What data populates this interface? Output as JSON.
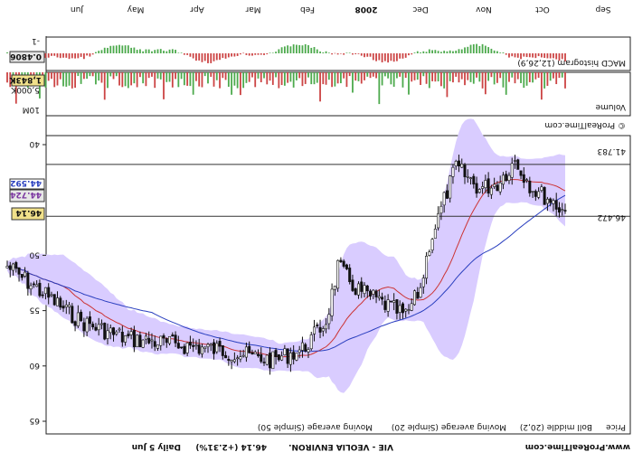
{
  "chart_data": {
    "type": "candlestick",
    "orientation_note": "image is rendered upside-down (rotated 180°) relative to normal reading",
    "footer": {
      "source": "www.ProRealTime.com",
      "title": "VIE - VEOLIA ENVIRON.",
      "last_change": "46.14 (+2.31%)",
      "period": "Daily 5 Jun"
    },
    "copyright": "© ProRealTime.com",
    "legend": [
      "Price",
      "Boll middle (20,2)",
      "Moving average (Simple 20)",
      "Moving average (Simple 50)"
    ],
    "colors": {
      "candle": "#111111",
      "boll_band": "#d9ccff",
      "boll_middle": "#9b8ccc",
      "sma20": "#cc3333",
      "sma50": "#2a3fbf",
      "up_bar": "#4daa4d",
      "down_bar": "#cc4444",
      "box_price": "#f0e08a",
      "box_sma": "#e6e6e6",
      "box_purple": "#7a35a0"
    },
    "x_axis": {
      "labels": [
        "Sep",
        "Oct",
        "Nov",
        "Dec",
        "2008",
        "Feb",
        "Mar",
        "Apr",
        "May",
        "Jun"
      ]
    },
    "price_axis": {
      "tick_labels": [
        "40",
        "50",
        "55",
        "60",
        "65"
      ],
      "min": 40,
      "max": 65
    },
    "reference_lines": [
      41.783,
      46.472
    ],
    "price_boxes": {
      "last": "46.14",
      "sma20": "44.724",
      "sma50": "44.592"
    },
    "volume_panel": {
      "label": "Volume",
      "tick_labels": [
        "10M",
        "5,000K"
      ],
      "value_box": "1,843K"
    },
    "macd_panel": {
      "label": "MACD histogram (12,26,9)",
      "tick_labels": [
        "-1"
      ],
      "value_box": "0.4806"
    }
  }
}
